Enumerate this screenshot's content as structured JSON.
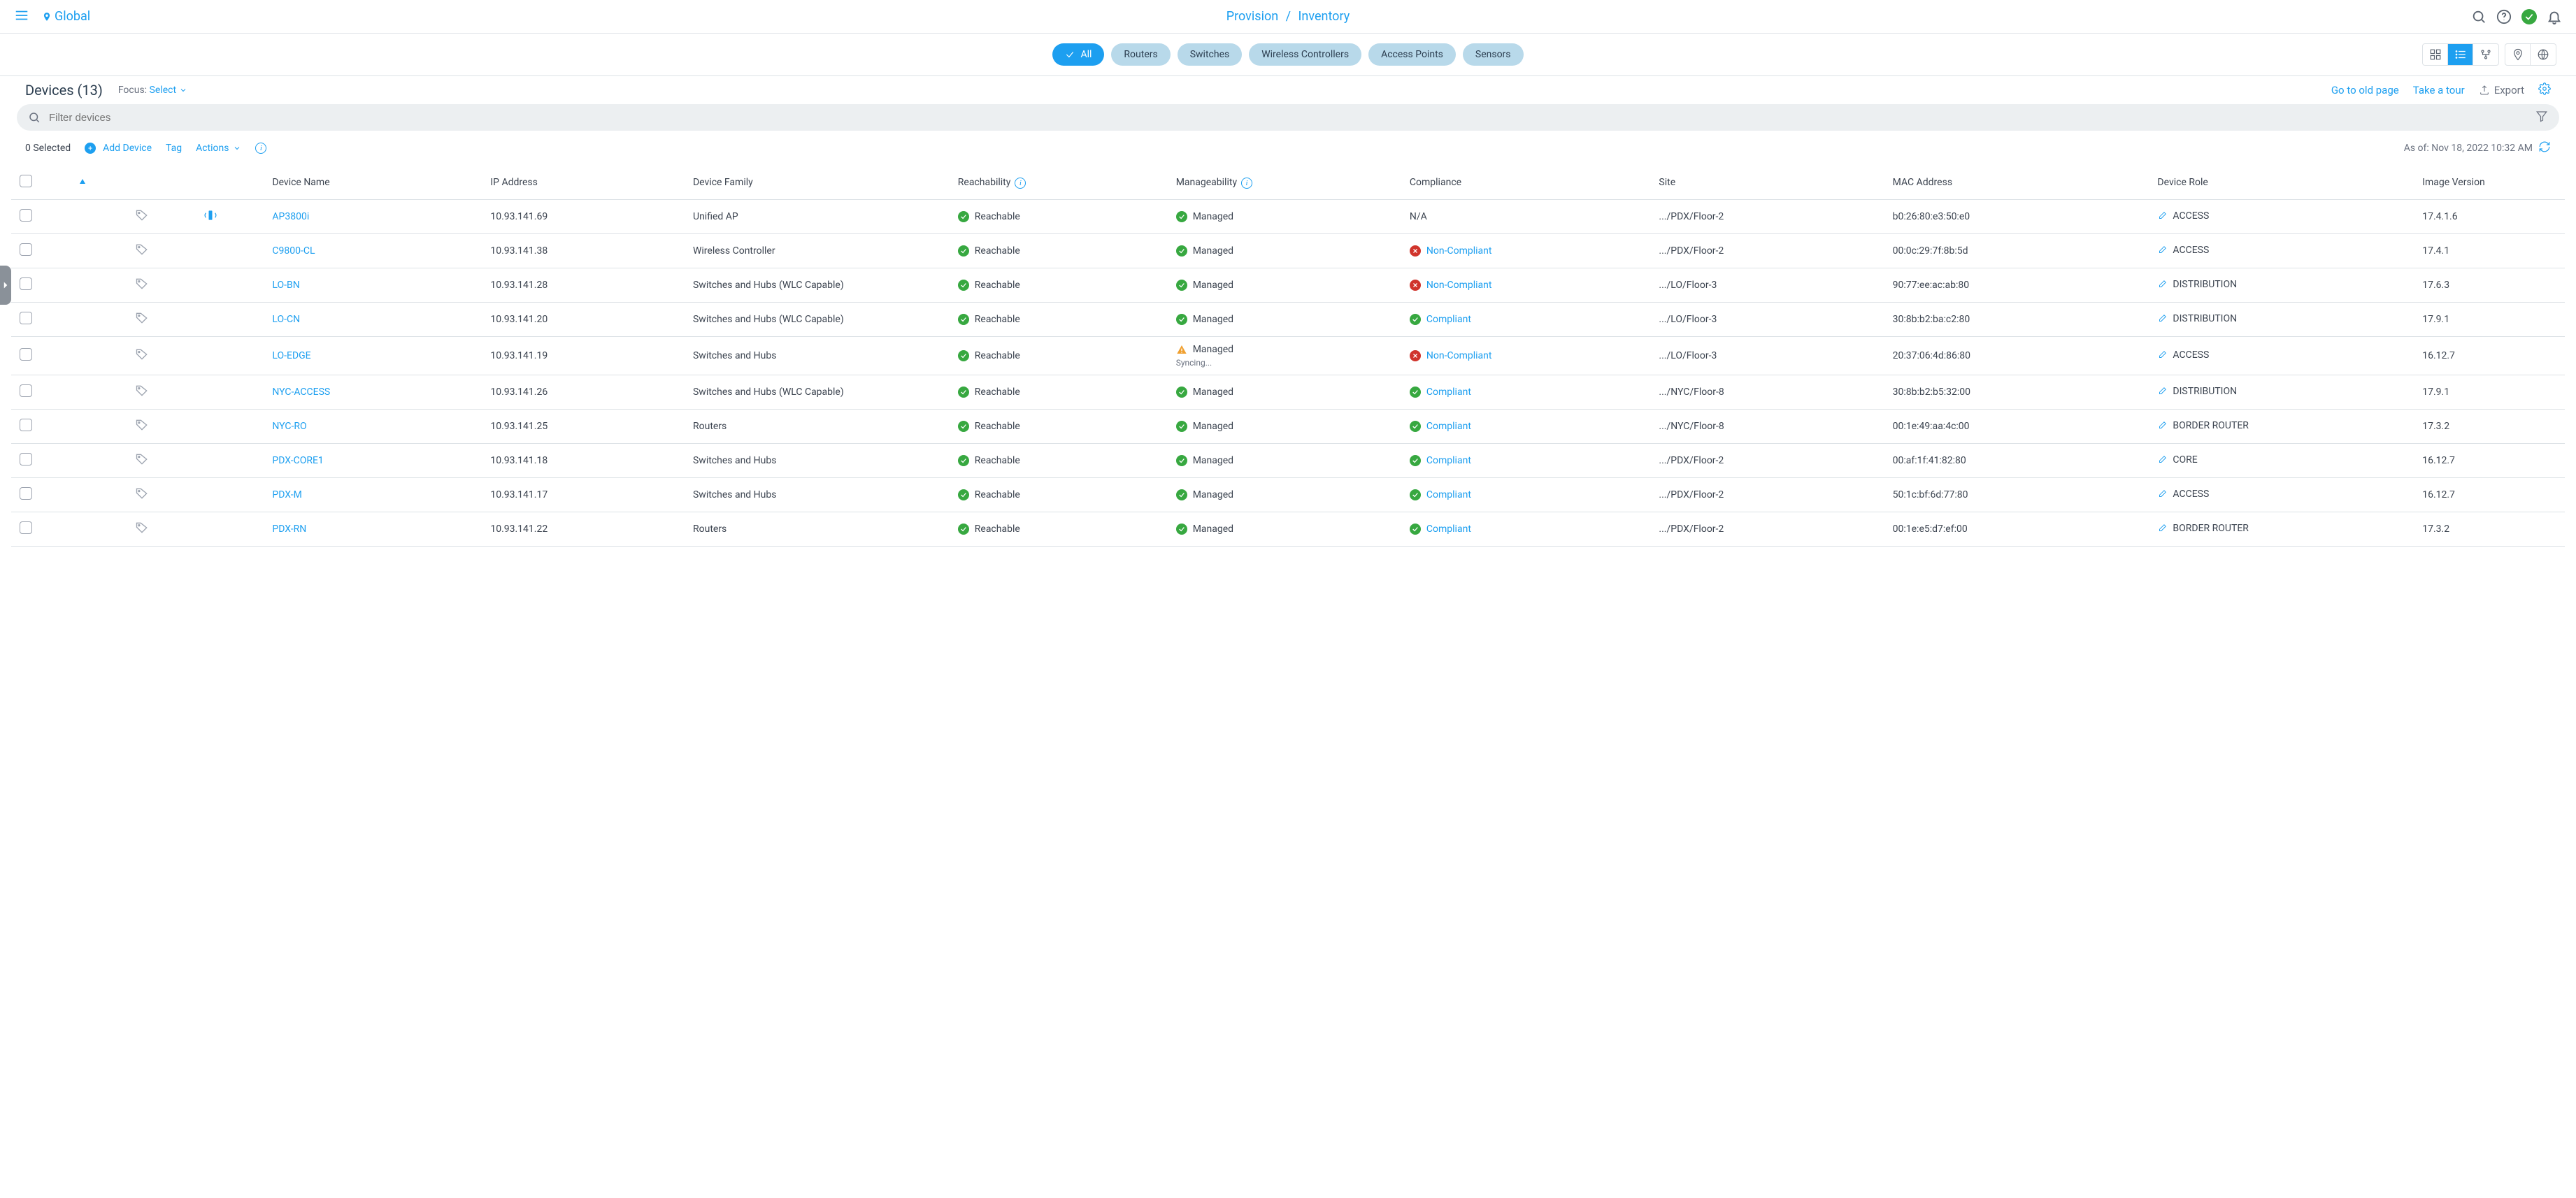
{
  "header": {
    "global": "Global",
    "breadcrumb": [
      "Provision",
      "Inventory"
    ]
  },
  "chips": {
    "active": "All",
    "others": [
      "Routers",
      "Switches",
      "Wireless Controllers",
      "Access Points",
      "Sensors"
    ]
  },
  "page": {
    "title": "Devices (13)",
    "focus_label": "Focus:",
    "focus_select": "Select",
    "go_old": "Go to old page",
    "tour": "Take a tour",
    "export": "Export"
  },
  "search": {
    "placeholder": "Filter devices"
  },
  "toolbar": {
    "selected": "0 Selected",
    "add_device": "Add Device",
    "tag": "Tag",
    "actions": "Actions",
    "as_of": "As of: Nov 18, 2022 10:32 AM"
  },
  "columns": {
    "name": "Device Name",
    "ip": "IP Address",
    "fam": "Device Family",
    "reach": "Reachability",
    "man": "Manageability",
    "comp": "Compliance",
    "site": "Site",
    "mac": "MAC Address",
    "role": "Device Role",
    "ver": "Image Version"
  },
  "rows": [
    {
      "name": "AP3800i",
      "ip": "10.93.141.69",
      "fam": "Unified AP",
      "reach": "Reachable",
      "reach_s": "green",
      "man": "Managed",
      "man_s": "green",
      "comp": "N/A",
      "comp_s": "none",
      "site": ".../PDX/Floor-2",
      "mac": "b0:26:80:e3:50:e0",
      "role": "ACCESS",
      "ver": "17.4.1.6",
      "icon": true
    },
    {
      "name": "C9800-CL",
      "ip": "10.93.141.38",
      "fam": "Wireless Controller",
      "reach": "Reachable",
      "reach_s": "green",
      "man": "Managed",
      "man_s": "green",
      "comp": "Non-Compliant",
      "comp_s": "red",
      "site": ".../PDX/Floor-2",
      "mac": "00:0c:29:7f:8b:5d",
      "role": "ACCESS",
      "ver": "17.4.1"
    },
    {
      "name": "LO-BN",
      "ip": "10.93.141.28",
      "fam": "Switches and Hubs (WLC Capable)",
      "reach": "Reachable",
      "reach_s": "green",
      "man": "Managed",
      "man_s": "green",
      "comp": "Non-Compliant",
      "comp_s": "red",
      "site": ".../LO/Floor-3",
      "mac": "90:77:ee:ac:ab:80",
      "role": "DISTRIBUTION",
      "ver": "17.6.3"
    },
    {
      "name": "LO-CN",
      "ip": "10.93.141.20",
      "fam": "Switches and Hubs (WLC Capable)",
      "reach": "Reachable",
      "reach_s": "green",
      "man": "Managed",
      "man_s": "green",
      "comp": "Compliant",
      "comp_s": "green",
      "site": ".../LO/Floor-3",
      "mac": "30:8b:b2:ba:c2:80",
      "role": "DISTRIBUTION",
      "ver": "17.9.1"
    },
    {
      "name": "LO-EDGE",
      "ip": "10.93.141.19",
      "fam": "Switches and Hubs",
      "reach": "Reachable",
      "reach_s": "green",
      "man": "Managed",
      "man_s": "orange",
      "man_sub": "Syncing...",
      "comp": "Non-Compliant",
      "comp_s": "red",
      "site": ".../LO/Floor-3",
      "mac": "20:37:06:4d:86:80",
      "role": "ACCESS",
      "ver": "16.12.7"
    },
    {
      "name": "NYC-ACCESS",
      "ip": "10.93.141.26",
      "fam": "Switches and Hubs (WLC Capable)",
      "reach": "Reachable",
      "reach_s": "green",
      "man": "Managed",
      "man_s": "green",
      "comp": "Compliant",
      "comp_s": "green",
      "site": ".../NYC/Floor-8",
      "mac": "30:8b:b2:b5:32:00",
      "role": "DISTRIBUTION",
      "ver": "17.9.1"
    },
    {
      "name": "NYC-RO",
      "ip": "10.93.141.25",
      "fam": "Routers",
      "reach": "Reachable",
      "reach_s": "green",
      "man": "Managed",
      "man_s": "green",
      "comp": "Compliant",
      "comp_s": "green",
      "site": ".../NYC/Floor-8",
      "mac": "00:1e:49:aa:4c:00",
      "role": "BORDER ROUTER",
      "ver": "17.3.2"
    },
    {
      "name": "PDX-CORE1",
      "ip": "10.93.141.18",
      "fam": "Switches and Hubs",
      "reach": "Reachable",
      "reach_s": "green",
      "man": "Managed",
      "man_s": "green",
      "comp": "Compliant",
      "comp_s": "green",
      "site": ".../PDX/Floor-2",
      "mac": "00:af:1f:41:82:80",
      "role": "CORE",
      "ver": "16.12.7"
    },
    {
      "name": "PDX-M",
      "ip": "10.93.141.17",
      "fam": "Switches and Hubs",
      "reach": "Reachable",
      "reach_s": "green",
      "man": "Managed",
      "man_s": "green",
      "comp": "Compliant",
      "comp_s": "green",
      "site": ".../PDX/Floor-2",
      "mac": "50:1c:bf:6d:77:80",
      "role": "ACCESS",
      "ver": "16.12.7"
    },
    {
      "name": "PDX-RN",
      "ip": "10.93.141.22",
      "fam": "Routers",
      "reach": "Reachable",
      "reach_s": "green",
      "man": "Managed",
      "man_s": "green",
      "comp": "Compliant",
      "comp_s": "green",
      "site": ".../PDX/Floor-2",
      "mac": "00:1e:e5:d7:ef:00",
      "role": "BORDER ROUTER",
      "ver": "17.3.2"
    }
  ]
}
